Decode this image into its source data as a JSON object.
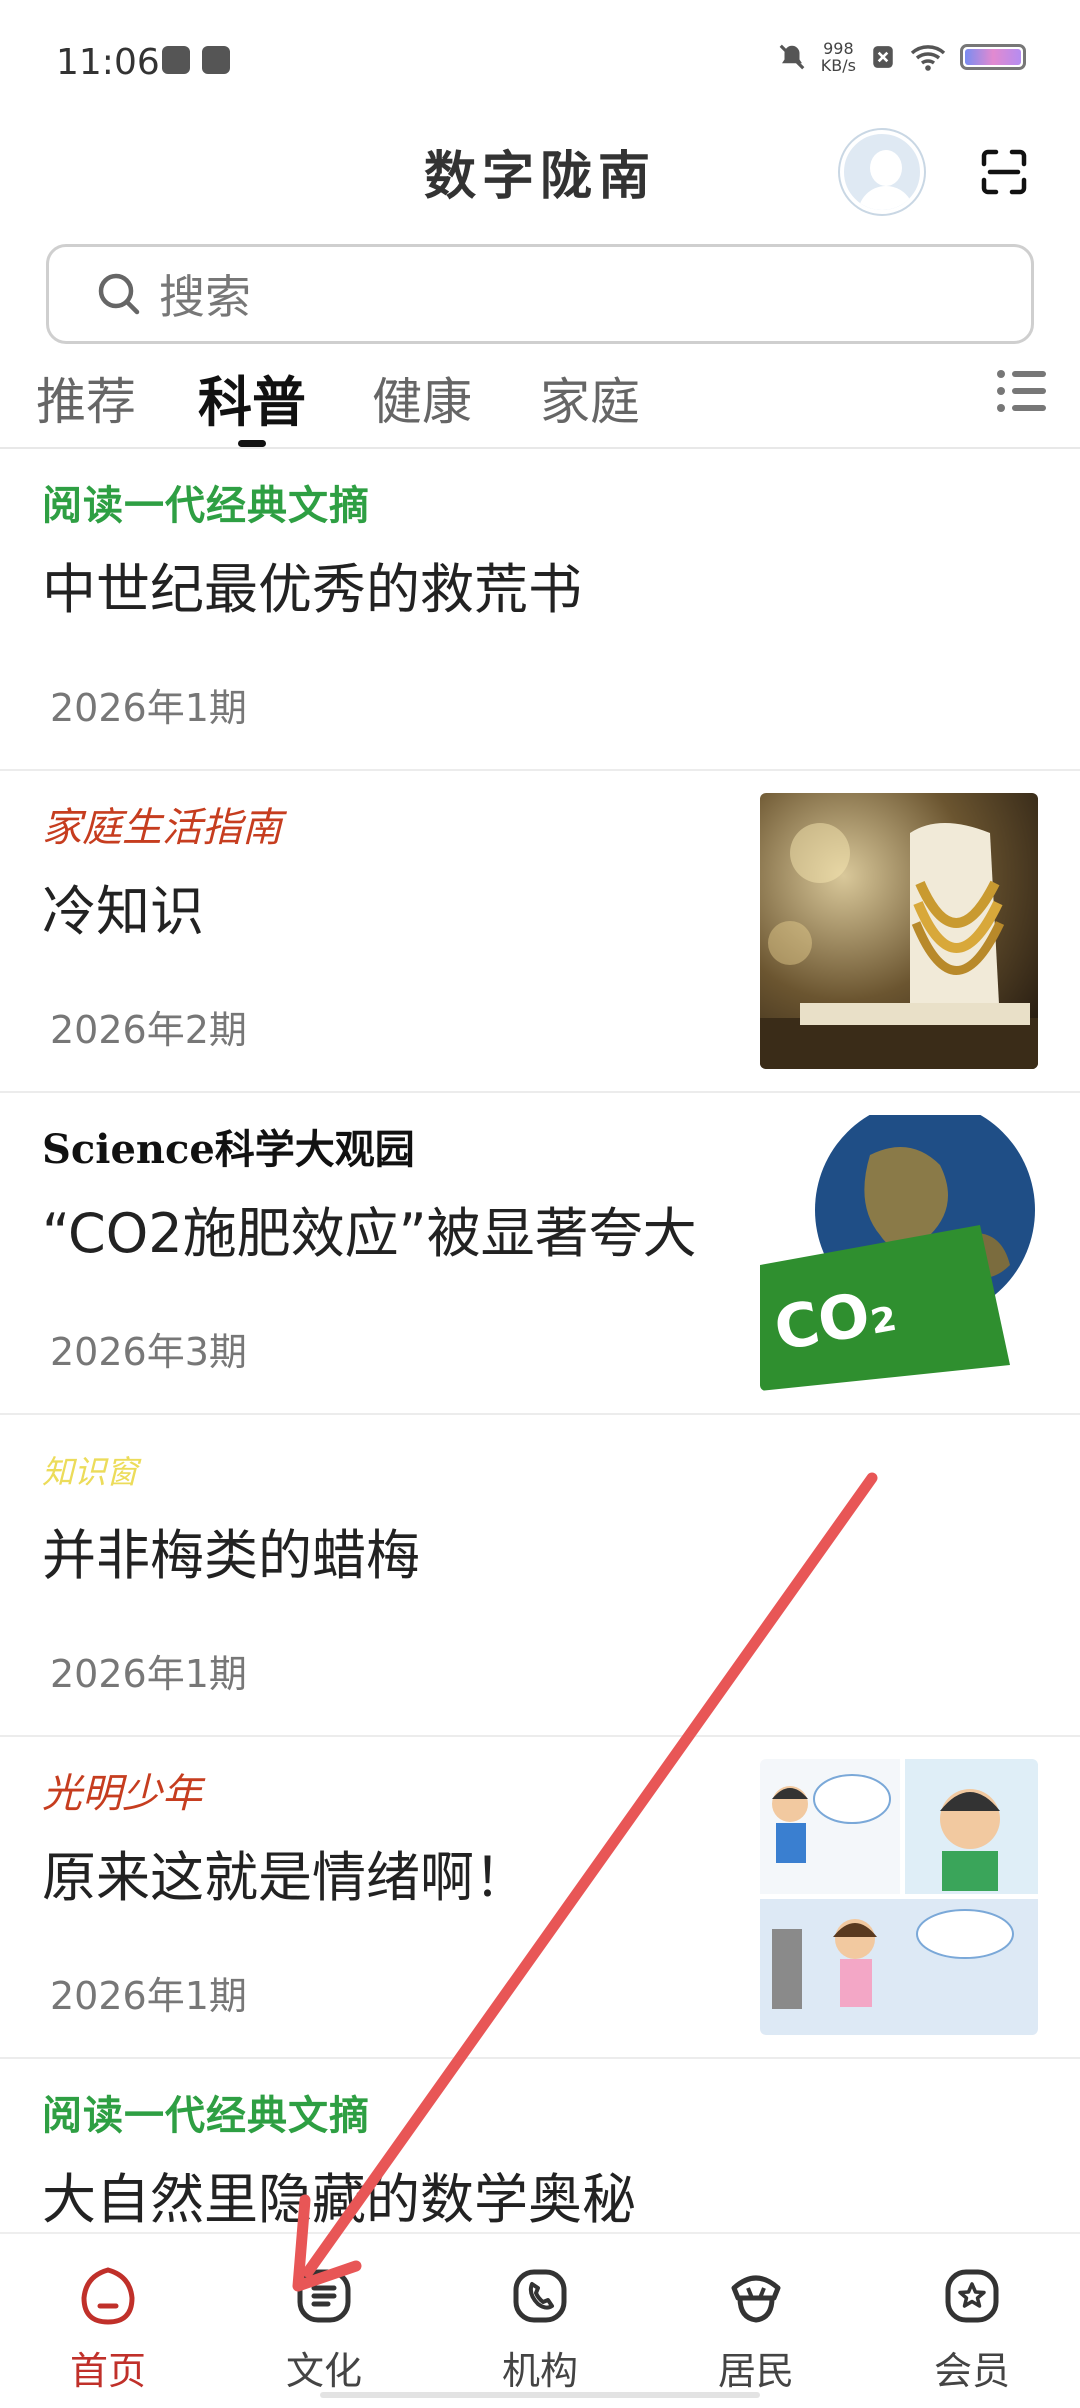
{
  "status_bar": {
    "time": "11:06",
    "net_speed_value": "998",
    "net_speed_unit": "KB/s"
  },
  "header": {
    "app_title": "数字陇南"
  },
  "search": {
    "placeholder": "搜索"
  },
  "tabs": [
    {
      "label": "推荐",
      "active": false
    },
    {
      "label": "科普",
      "active": true
    },
    {
      "label": "健康",
      "active": false
    },
    {
      "label": "家庭",
      "active": false
    }
  ],
  "articles": [
    {
      "source": "阅读一代经典文摘",
      "title": "中世纪最优秀的救荒书",
      "issue": "2026年1期",
      "has_thumb": false
    },
    {
      "source": "家庭生活指南",
      "title": "冷知识",
      "issue": "2026年2期",
      "has_thumb": true,
      "thumb": "jewelry-necklace-photo"
    },
    {
      "source": "Science科学大观园",
      "title": "“CO2施肥效应”被显著夸大",
      "issue": "2026年3期",
      "has_thumb": true,
      "thumb": "co2-earth-illustration",
      "thumb_text": "CO₂"
    },
    {
      "source": "知识窗",
      "title": "并非梅类的蜡梅",
      "issue": "2026年1期",
      "has_thumb": false
    },
    {
      "source": "光明少年",
      "title": "原来这就是情绪啊！",
      "issue": "2026年1期",
      "has_thumb": true,
      "thumb": "kids-emotion-comic"
    },
    {
      "source": "阅读一代经典文摘",
      "title": "大自然里隐藏的数学奥秘",
      "issue": "",
      "has_thumb": false
    }
  ],
  "bottom_nav": [
    {
      "label": "首页",
      "icon": "home-icon",
      "active": true
    },
    {
      "label": "文化",
      "icon": "culture-icon",
      "active": false
    },
    {
      "label": "机构",
      "icon": "phone-icon",
      "active": false
    },
    {
      "label": "居民",
      "icon": "resident-icon",
      "active": false
    },
    {
      "label": "会员",
      "icon": "member-star-icon",
      "active": false
    }
  ],
  "colors": {
    "accent_red": "#c0302a",
    "source_green": "#2e9f43",
    "source_red": "#c63d1f",
    "annotation_arrow": "#e85656"
  }
}
